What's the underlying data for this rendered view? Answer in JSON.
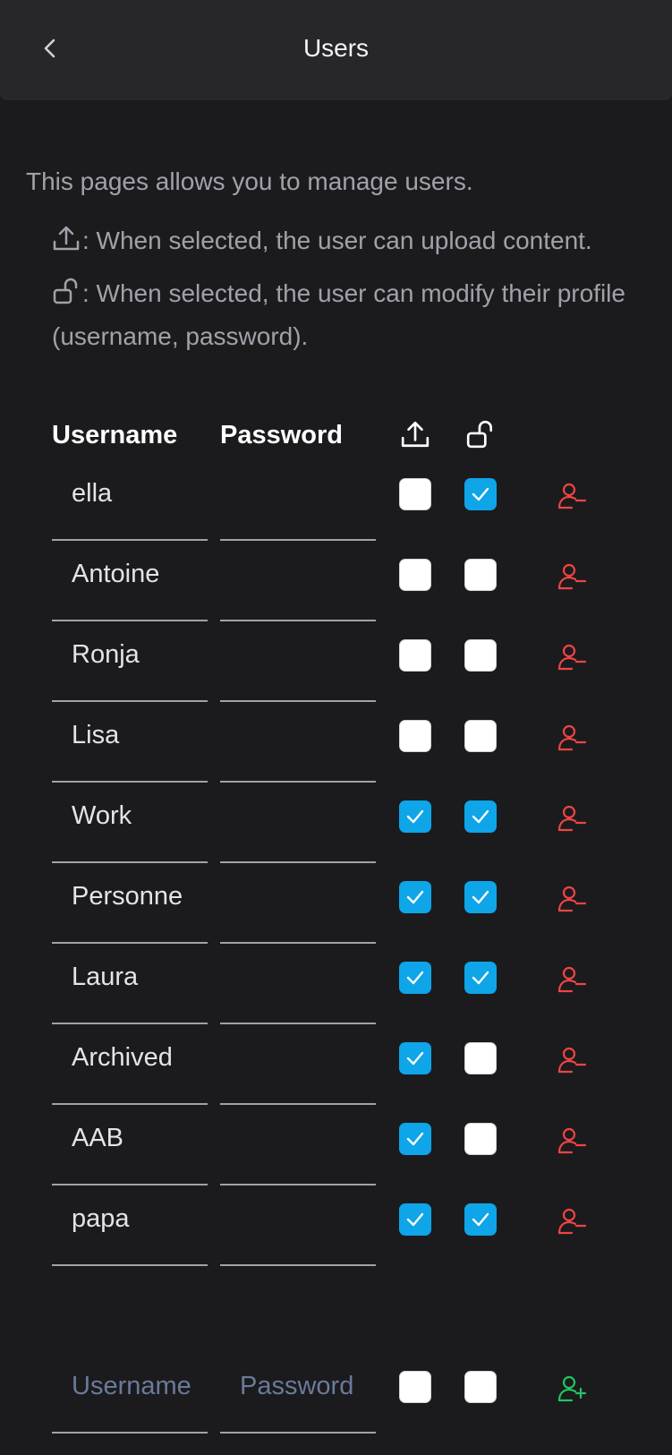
{
  "header": {
    "title": "Users"
  },
  "intro": {
    "text": "This pages allows you to manage users.",
    "upload_help": ": When selected, the user can upload content.",
    "lock_help": ": When selected, the user can modify their profile (username, password)."
  },
  "table": {
    "col_username": "Username",
    "col_password": "Password",
    "col_upload_icon": "upload-icon",
    "col_lock_icon": "unlock-icon"
  },
  "users": [
    {
      "username": "ella",
      "password": "",
      "upload": false,
      "modify": true
    },
    {
      "username": "Antoine",
      "password": "",
      "upload": false,
      "modify": false
    },
    {
      "username": "Ronja",
      "password": "",
      "upload": false,
      "modify": false
    },
    {
      "username": "Lisa",
      "password": "",
      "upload": false,
      "modify": false
    },
    {
      "username": "Work",
      "password": "",
      "upload": true,
      "modify": true
    },
    {
      "username": "Personne",
      "password": "",
      "upload": true,
      "modify": true
    },
    {
      "username": "Laura",
      "password": "",
      "upload": true,
      "modify": true
    },
    {
      "username": "Archived",
      "password": "",
      "upload": true,
      "modify": false
    },
    {
      "username": "AAB",
      "password": "",
      "upload": true,
      "modify": false
    },
    {
      "username": "papa",
      "password": "",
      "upload": true,
      "modify": true
    }
  ],
  "new_user": {
    "username_placeholder": "Username",
    "password_placeholder": "Password",
    "upload": false,
    "modify": false
  },
  "colors": {
    "checked": "#0ea5e9",
    "remove": "#ef4444",
    "add": "#22c55e"
  }
}
